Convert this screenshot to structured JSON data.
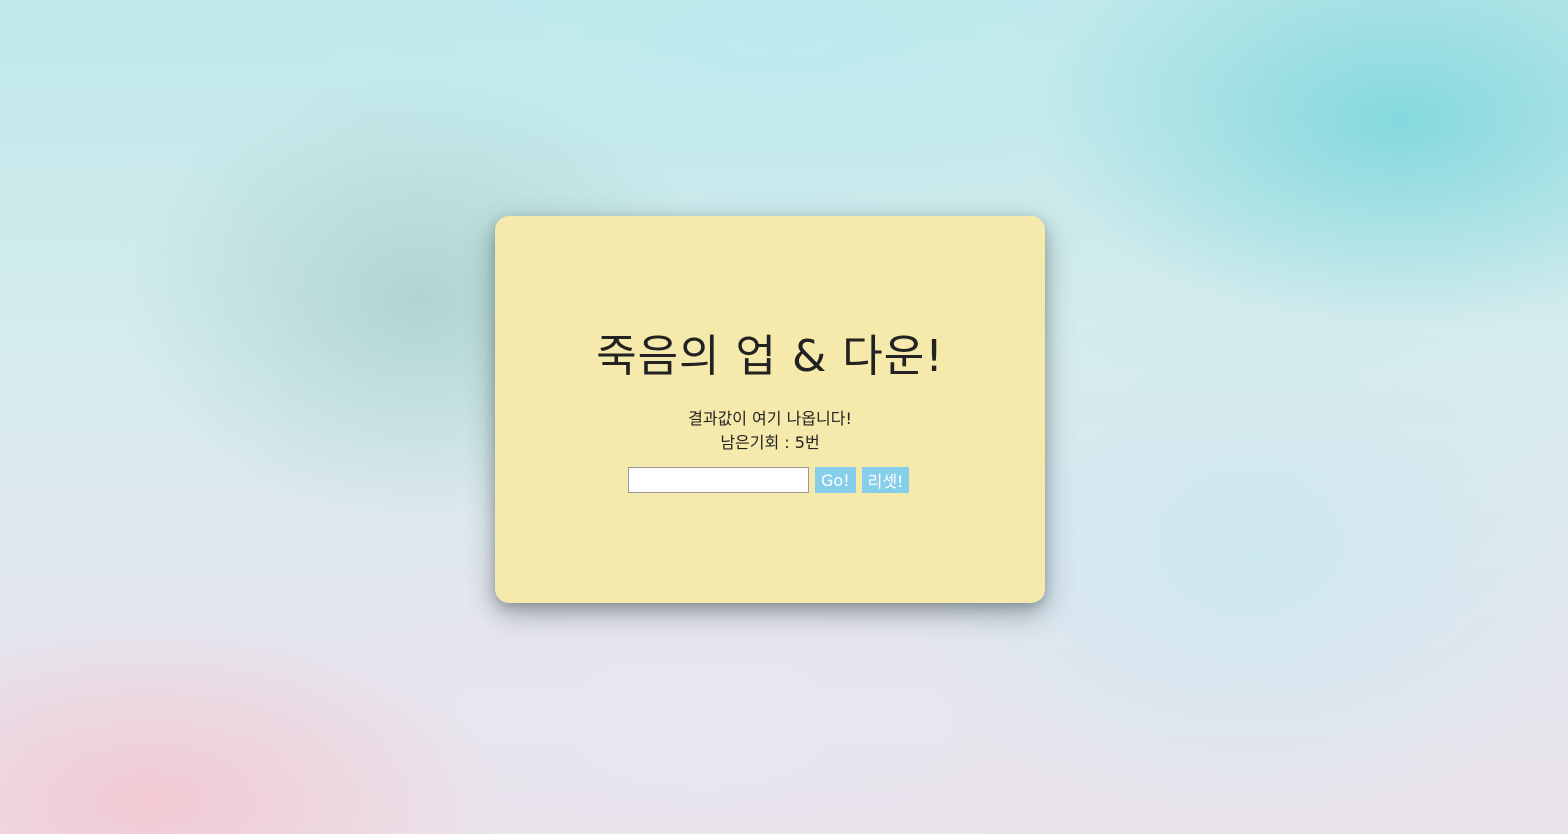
{
  "game": {
    "title": "죽음의 업 & 다운!",
    "result_text": "결과값이 여기 나옵니다!",
    "chances_text": "남은기회 : 5번",
    "input_value": "",
    "go_label": "Go!",
    "reset_label": "리셋!"
  },
  "colors": {
    "card": "#f5eaab",
    "button": "#87ceeb",
    "text": "#222222"
  }
}
